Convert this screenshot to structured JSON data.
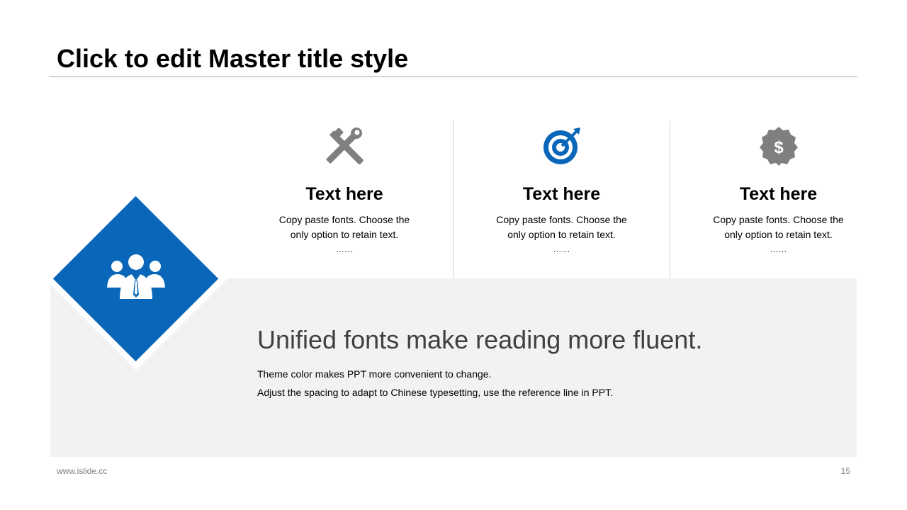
{
  "slide": {
    "title": "Click to edit Master title style",
    "headline": "Unified fonts make reading more fluent.",
    "body_lines": [
      "Theme color makes PPT more convenient to change.",
      "Adjust the spacing to adapt to Chinese typesetting, use the reference line in PPT."
    ],
    "center_icon": "team-people-icon",
    "columns": [
      {
        "icon": "tools-icon",
        "icon_color": "#7f7f7f",
        "heading": "Text here",
        "text": "Copy paste fonts. Choose the only option to retain text.",
        "dots": "……"
      },
      {
        "icon": "target-icon",
        "icon_color": "#0a66b8",
        "heading": "Text here",
        "text": "Copy paste fonts. Choose the only option to retain text.",
        "dots": "……"
      },
      {
        "icon": "dollar-badge-icon",
        "icon_color": "#7f7f7f",
        "heading": "Text here",
        "text": "Copy paste fonts. Choose the only option to retain text.",
        "dots": "……"
      }
    ]
  },
  "footer": {
    "url": "www.islide.cc",
    "page_number": "15"
  },
  "colors": {
    "accent": "#0a66b8",
    "panel": "#f2f2f2",
    "icon_gray": "#7f7f7f"
  }
}
